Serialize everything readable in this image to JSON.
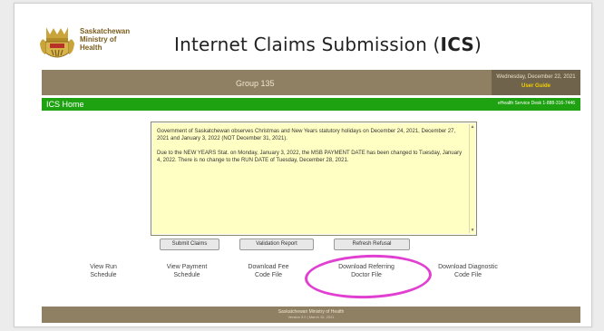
{
  "header": {
    "ministry_lines": [
      "Saskatchewan",
      "Ministry of",
      "Health"
    ],
    "title_prefix": "Internet Claims Submission (",
    "title_bold": "ICS",
    "title_suffix": ")",
    "logo_icon": "saskatchewan-crest-icon"
  },
  "banner": {
    "group": "Group 135",
    "date": "Wednesday, December 22, 2021",
    "user_guide": "User Guide"
  },
  "nav": {
    "home": "ICS Home",
    "service_desk": "eHealth Service Desk 1-888-316-7446"
  },
  "notice": {
    "paragraphs": [
      "Government of Saskatchewan observes Christmas and New Years statutory holidays on December 24, 2021, December 27, 2021 and January 3, 2022 (NOT December 31, 2021).",
      "Due to the NEW YEARS Stat. on Monday, January 3, 2022, the MSB PAYMENT DATE has been changed to Tuesday, January 4, 2022. There is no change to the RUN DATE of Tuesday, December 28, 2021."
    ],
    "scroll_up": "▲",
    "scroll_down": "▼"
  },
  "buttons": {
    "submit": "Submit Claims",
    "validation": "Validation Report",
    "refresh": "Refresh Refusal"
  },
  "links": [
    [
      "View Run",
      "Schedule"
    ],
    [
      "View Payment",
      "Schedule"
    ],
    [
      "Download Fee",
      "Code File"
    ],
    [
      "Download Referring",
      "Doctor File"
    ],
    [
      "Download Diagnostic",
      "Code File"
    ]
  ],
  "footer": {
    "line1": "Saskatchewan Ministry of Health",
    "line2": "Version 3.0 | March 10, 2021"
  },
  "colors": {
    "brown_bar": "#8f7f63",
    "green_bar": "#1ea212",
    "notice_bg": "#ffffc3",
    "highlight": "#e13fd2"
  }
}
